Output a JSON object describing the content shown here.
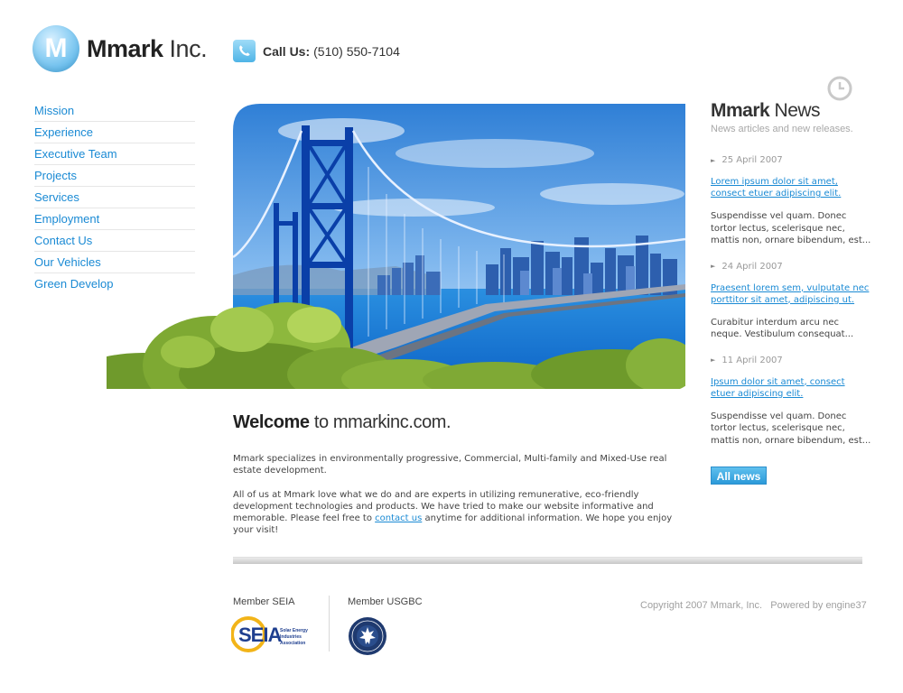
{
  "header": {
    "logo_letter": "M",
    "logo_bold": "Mmark",
    "logo_rest": " Inc.",
    "call_label": "Call Us:",
    "phone": "(510) 550-7104"
  },
  "nav": {
    "items": [
      {
        "label": "Mission"
      },
      {
        "label": "Experience"
      },
      {
        "label": "Executive Team"
      },
      {
        "label": "Projects"
      },
      {
        "label": "Services"
      },
      {
        "label": "Employment"
      },
      {
        "label": "Contact Us"
      },
      {
        "label": "Our Vehicles"
      },
      {
        "label": "Green Develop"
      }
    ]
  },
  "news": {
    "title_bold": "Mmark",
    "title_rest": " News",
    "subtitle": "News articles and new releases.",
    "items": [
      {
        "date": "25 April 2007",
        "headline": "Lorem ipsum dolor sit amet, consect etuer adipiscing elit.",
        "summary": "Suspendisse vel quam. Donec tortor lectus, scelerisque nec, mattis non, ornare bibendum, est..."
      },
      {
        "date": "24 April 2007",
        "headline": "Praesent lorem sem, vulputate nec porttitor sit amet, adipiscing ut.",
        "summary": "Curabitur interdum arcu nec neque. Vestibulum consequat..."
      },
      {
        "date": "11 April 2007",
        "headline": "Ipsum dolor sit amet, consect etuer adipiscing elit.",
        "summary": "Suspendisse vel quam. Donec tortor lectus, scelerisque nec, mattis non, ornare bibendum, est..."
      }
    ],
    "all_news_label": "All news"
  },
  "welcome": {
    "title_bold": "Welcome",
    "title_rest": " to mmarkinc.com.",
    "para1": "Mmark specializes in environmentally progressive, Commercial, Multi-family and Mixed-Use real estate development.",
    "para2_before": "All of us at Mmark love what we do and are experts in utilizing remunerative, eco-friendly development technologies and products. We have tried to make our website informative and memorable.  Please feel free to ",
    "para2_link": "contact us",
    "para2_after": " anytime for additional information.  We hope you enjoy your visit!"
  },
  "footer": {
    "member_seia": "Member SEIA",
    "member_usgbc": "Member USGBC",
    "seia_logo_text": "SEIA",
    "seia_logo_sub": [
      "Solar Energy",
      "Industries",
      "Association"
    ],
    "copyright": "Copyright 2007 Mmark, Inc.",
    "powered": "Powered by engine37"
  },
  "colors": {
    "accent_blue": "#1a8ad4",
    "logo_blue": "#3ea6e2",
    "text_dark": "#333333",
    "muted": "#a0a0a0"
  },
  "icons": [
    "phone-icon",
    "clock-icon",
    "news-arrow-icon",
    "seia-logo",
    "usgbc-logo"
  ]
}
